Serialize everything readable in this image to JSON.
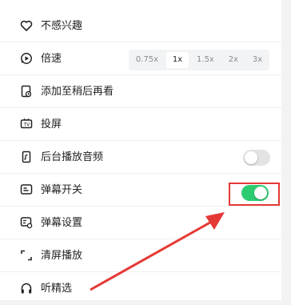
{
  "menu": {
    "not_interested": {
      "label": "不感兴趣",
      "icon": "heart-icon"
    },
    "speed": {
      "label": "倍速",
      "icon": "playback-speed-icon",
      "options": [
        "0.75x",
        "1x",
        "1.5x",
        "2x",
        "3x"
      ],
      "selected": "1x"
    },
    "watch_later": {
      "label": "添加至稍后再看",
      "icon": "watch-later-icon"
    },
    "cast": {
      "label": "投屏",
      "icon": "tv-cast-icon"
    },
    "background_audio": {
      "label": "后台播放音频",
      "icon": "phone-audio-icon",
      "toggle": false
    },
    "danmaku_switch": {
      "label": "弹幕开关",
      "icon": "danmaku-icon",
      "toggle": true
    },
    "danmaku_settings": {
      "label": "弹幕设置",
      "icon": "danmaku-settings-icon"
    },
    "clear_screen": {
      "label": "清屏播放",
      "icon": "clear-screen-icon"
    },
    "listen": {
      "label": "听精选",
      "icon": "headphones-icon"
    }
  },
  "colors": {
    "toggle_on": "#2ecc71",
    "toggle_off": "#e3e3e3",
    "annotation_red": "#e53935"
  },
  "annotation": {
    "highlight": "danmaku_switch toggle",
    "arrow": "red arrow pointing to toggle"
  }
}
